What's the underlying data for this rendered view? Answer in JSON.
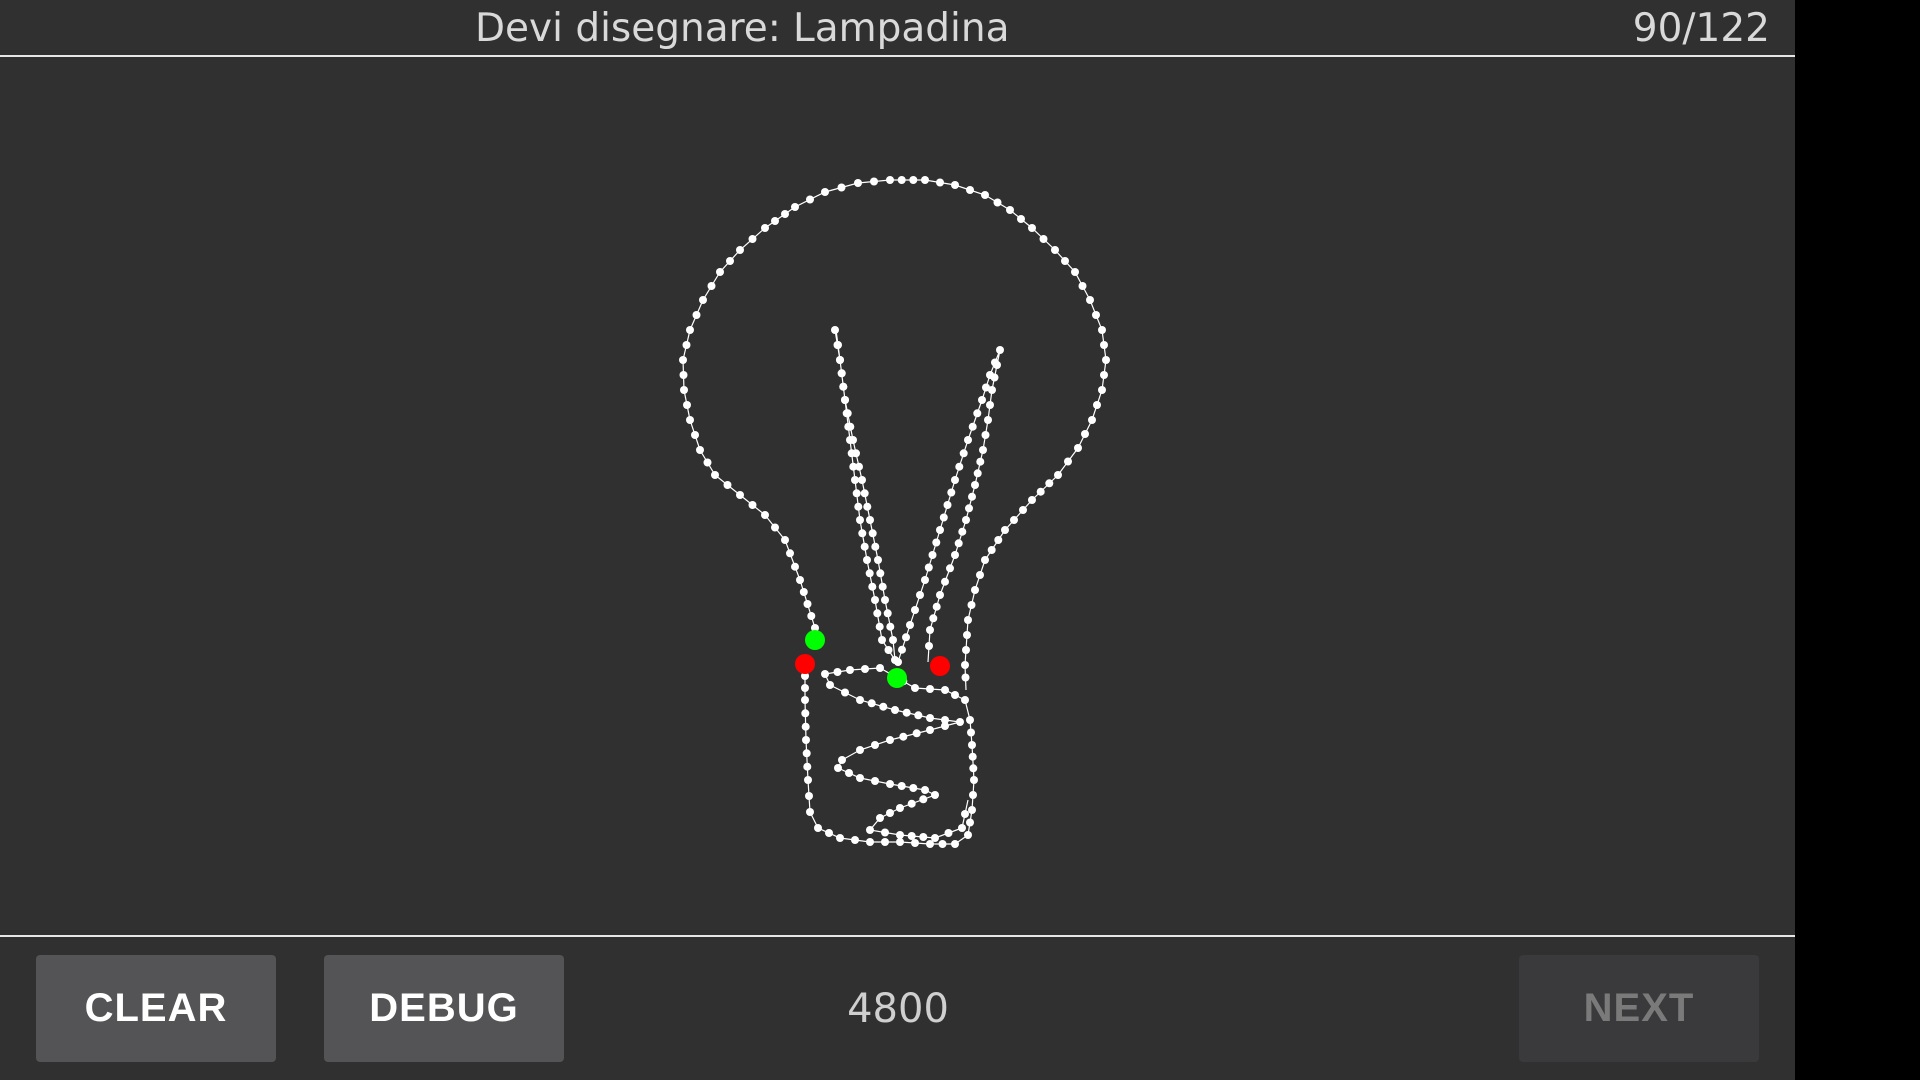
{
  "header": {
    "prompt_label": "Devi disegnare:",
    "prompt_word": "Lampadina",
    "progress": "90/122"
  },
  "drawing": {
    "subject": "light-bulb sketch",
    "stroke_color": "#ffffff",
    "start_marker_color": "#00ff00",
    "end_marker_color": "#ff0000"
  },
  "footer": {
    "clear_label": "CLEAR",
    "debug_label": "DEBUG",
    "score": "4800",
    "next_label": "NEXT"
  },
  "colors": {
    "background": "#303030",
    "divider": "#e6e6e6",
    "button_bg": "#545456",
    "button_disabled_bg": "#3a3a3c",
    "text": "#d9d9d9"
  }
}
